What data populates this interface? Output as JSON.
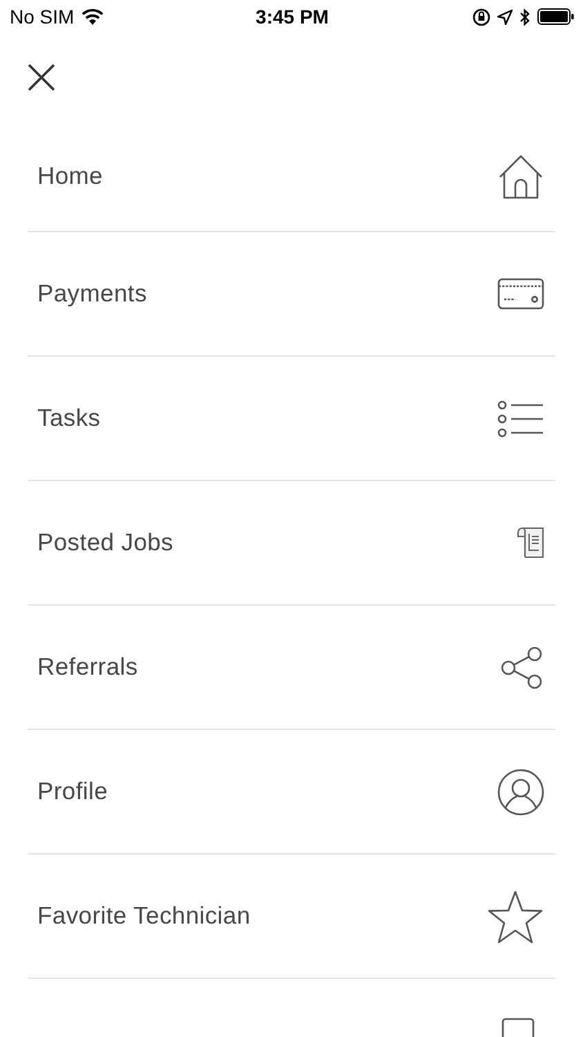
{
  "status_bar": {
    "carrier": "No SIM",
    "time": "3:45 PM"
  },
  "menu": {
    "items": [
      {
        "label": "Home",
        "kind": "home"
      },
      {
        "label": "Payments",
        "kind": "card"
      },
      {
        "label": "Tasks",
        "kind": "list"
      },
      {
        "label": "Posted Jobs",
        "kind": "document"
      },
      {
        "label": "Referrals",
        "kind": "share"
      },
      {
        "label": "Profile",
        "kind": "profile"
      },
      {
        "label": "Favorite Technician",
        "kind": "star"
      },
      {
        "kind": "logout"
      }
    ]
  }
}
